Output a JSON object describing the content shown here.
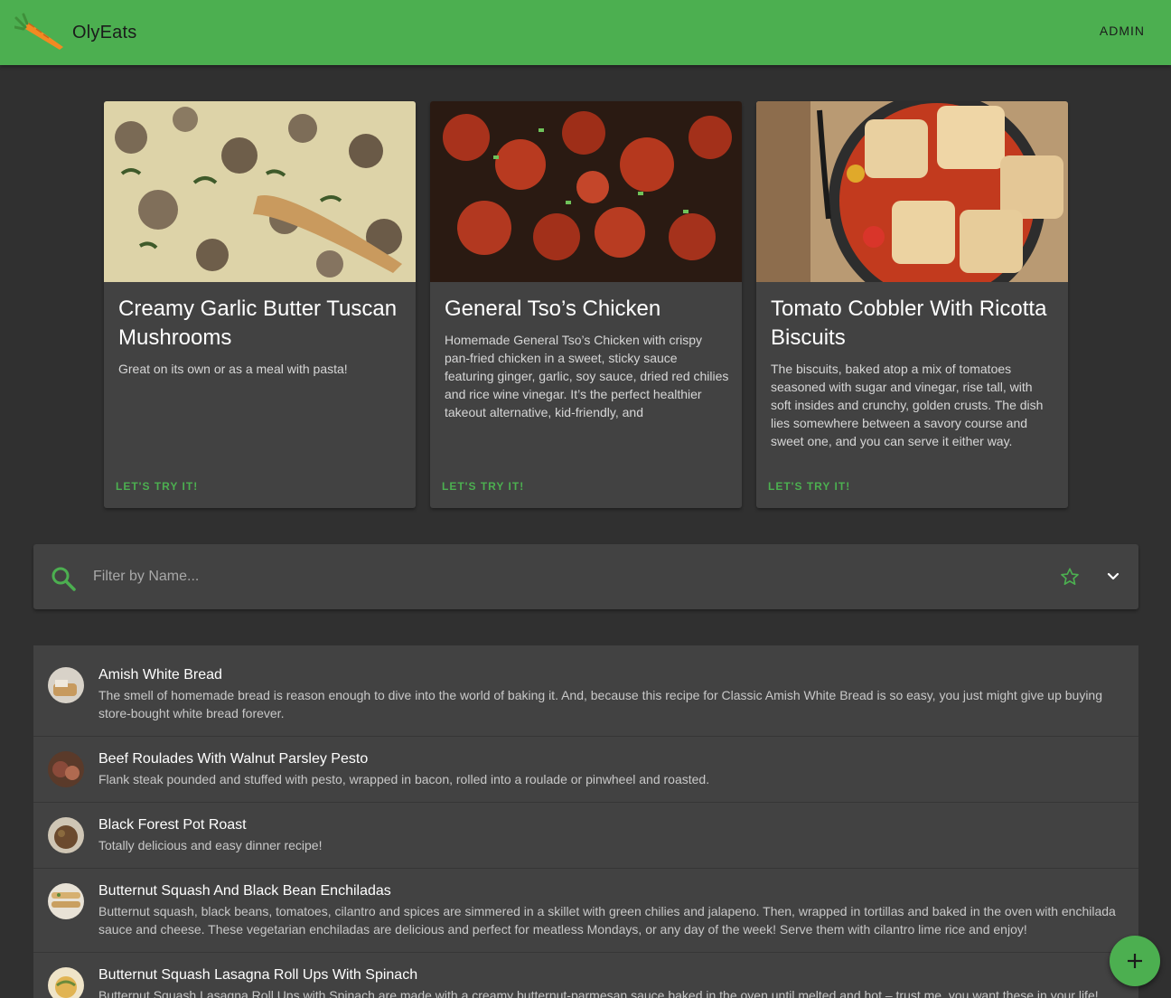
{
  "app": {
    "title": "OlyEats",
    "admin_label": "ADMIN",
    "accent_color": "#4caf50",
    "background_color": "#303030",
    "surface_color": "#424242"
  },
  "featured": [
    {
      "title": "Creamy Garlic Butter Tuscan Mushrooms",
      "description": "Great on its own or as a meal with pasta!",
      "action_label": "LET'S TRY IT!",
      "image_icon": "mushrooms-photo"
    },
    {
      "title": "General Tso’s Chicken",
      "description": "Homemade General Tso’s Chicken with crispy pan-fried chicken in a sweet, sticky sauce featuring ginger, garlic, soy sauce, dried red chilies and rice wine vinegar. It’s the perfect healthier takeout alternative, kid-friendly, and",
      "action_label": "LET'S TRY IT!",
      "image_icon": "chicken-photo"
    },
    {
      "title": "Tomato Cobbler With Ricotta Biscuits",
      "description": "The biscuits, baked atop a mix of tomatoes seasoned with sugar and vinegar, rise tall, with soft insides and crunchy, golden crusts. The dish lies somewhere between a savory course and sweet one, and you can serve it either way.",
      "action_label": "LET'S TRY IT!",
      "image_icon": "cobbler-photo"
    }
  ],
  "search": {
    "placeholder": "Filter by Name...",
    "value": "",
    "favorite_icon": "star-outline-icon",
    "expand_icon": "chevron-down-icon"
  },
  "recipes": [
    {
      "name": "Amish White Bread",
      "description": "The smell of homemade bread is reason enough to dive into the world of baking it. And, because this recipe for Classic Amish White Bread is so easy, you just might give up buying store-bought white bread forever."
    },
    {
      "name": "Beef Roulades With Walnut Parsley Pesto",
      "description": "Flank steak pounded and stuffed with pesto, wrapped in bacon, rolled into a roulade or pinwheel and roasted."
    },
    {
      "name": "Black Forest Pot Roast",
      "description": "Totally delicious and easy dinner recipe!"
    },
    {
      "name": "Butternut Squash And Black Bean Enchiladas",
      "description": "Butternut squash, black beans, tomatoes, cilantro and spices are simmered in a skillet with green chilies and jalapeno. Then, wrapped in tortillas and baked in the oven with enchilada sauce and cheese. These vegetarian enchiladas are delicious and perfect for meatless Mondays, or any day of the week! Serve them with cilantro lime rice and enjoy!"
    },
    {
      "name": "Butternut Squash Lasagna Roll Ups With Spinach",
      "description": "Butternut Squash Lasagna Roll Ups with Spinach are made with a creamy butternut-parmesan sauce baked in the oven until melted and hot – trust me, you want these in your life!"
    }
  ],
  "fab": {
    "icon": "plus-icon"
  }
}
